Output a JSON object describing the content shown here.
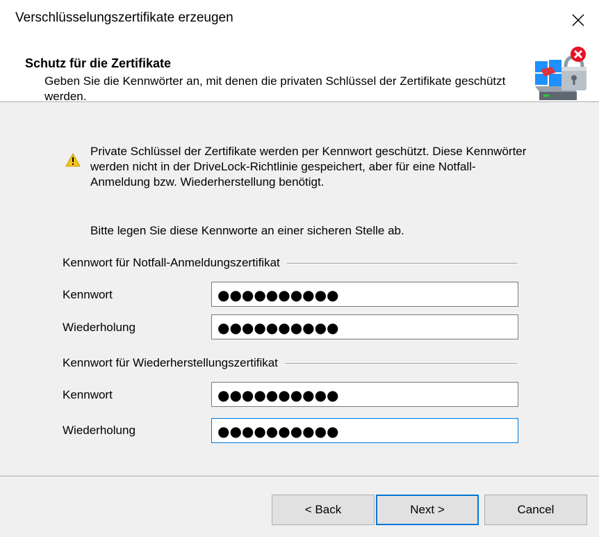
{
  "window": {
    "title": "Verschlüsselungszertifikate erzeugen",
    "close_glyph": "✕"
  },
  "header": {
    "title": "Schutz für die Zertifikate",
    "description": "Geben Sie die Kennwörter an, mit denen die privaten Schlüssel der Zertifikate geschützt werden.",
    "icon": "drivelock-certificate-lock-icon"
  },
  "warning": {
    "icon": "warning-icon",
    "text": "Private Schlüssel der Zertifikate werden per Kennwort geschützt. Diese Kennwörter werden nicht in der DriveLock-Richtlinie gespeichert, aber für eine Notfall-Anmeldung bzw. Wiederherstellung benötigt.",
    "text2": "Bitte legen Sie diese Kennworte an einer sicheren Stelle ab."
  },
  "groups": [
    {
      "label": "Kennwort für Notfall-Anmeldungszertifikat",
      "password_label": "Kennwort",
      "password_value": "●●●●●●●●●●",
      "repeat_label": "Wiederholung",
      "repeat_value": "●●●●●●●●●●"
    },
    {
      "label": "Kennwort für Wiederherstellungszertifikat",
      "password_label": "Kennwort",
      "password_value": "●●●●●●●●●●",
      "repeat_label": "Wiederholung",
      "repeat_value": "●●●●●●●●●●"
    }
  ],
  "buttons": {
    "back": "< Back",
    "next": "Next >",
    "cancel": "Cancel"
  },
  "colors": {
    "accent": "#0078d7",
    "dialog_bg": "#f0f0f0",
    "warning": "#f5c518",
    "error_badge": "#e81123"
  }
}
